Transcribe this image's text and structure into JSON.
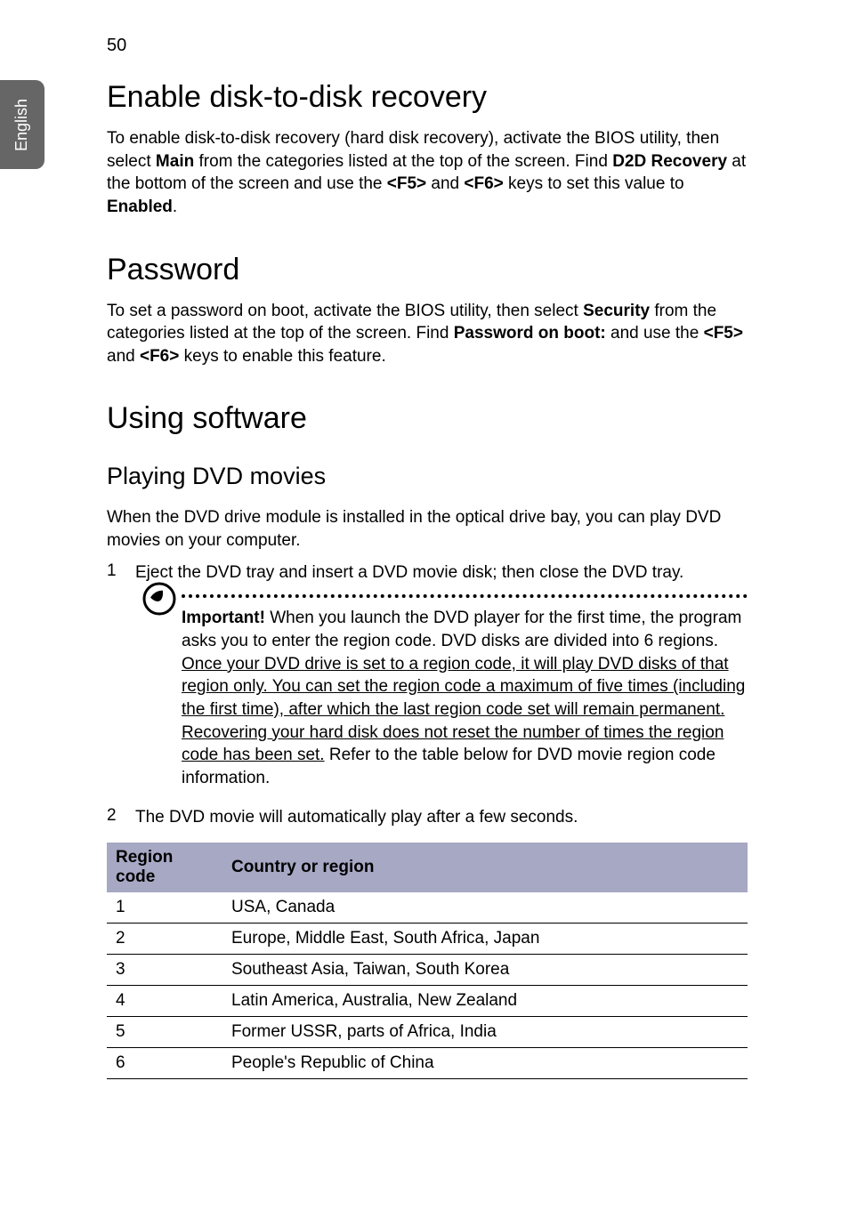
{
  "page_number": "50",
  "side_tab": "English",
  "section1": {
    "title": "Enable disk-to-disk recovery",
    "para_pre1": "To enable disk-to-disk recovery (hard disk recovery), activate the BIOS utility, then select ",
    "b1": "Main",
    "mid1": " from the categories listed at the top of the screen. Find ",
    "b2": "D2D Recovery",
    "mid2": " at the bottom of the screen and use the ",
    "b3": "<F5>",
    "mid3": " and ",
    "b4": "<F6>",
    "mid4": " keys to set this value to ",
    "b5": "Enabled",
    "end": "."
  },
  "section2": {
    "title": "Password",
    "pre1": "To set a password on boot, activate the BIOS utility, then select ",
    "b1": "Security",
    "mid1": " from the categories listed at the top of the screen. Find ",
    "b2": "Password on boot:",
    "mid2": " and use the ",
    "b3": "<F5>",
    "mid3": " and ",
    "b4": "<F6>",
    "end": " keys to enable this feature."
  },
  "section3": {
    "title": "Using software",
    "subtitle": "Playing DVD movies",
    "intro": "When the DVD drive module is installed in the optical drive bay, you can play DVD movies on your computer.",
    "step1_num": "1",
    "step1_text": "Eject the DVD tray and insert a DVD movie disk; then close the DVD tray.",
    "note": {
      "b1": "Important!",
      "t1": " When you launch the DVD player for the first time, the program asks you to enter the region code. DVD disks are divided into 6 regions. ",
      "u1": "Once your DVD drive is set to a region code, it will play DVD disks of that region only. You can set the region code a maximum of five times (including the first time), after which the last region code set will remain permanent. Recovering your hard disk does not reset the number of times the region code has been set.",
      "t2": " Refer to the table below for DVD movie region code information."
    },
    "step2_num": "2",
    "step2_text": "The DVD movie will automatically play after a few seconds.",
    "table": {
      "header1": "Region code",
      "header2": "Country or region",
      "rows": [
        {
          "code": "1",
          "region": "USA, Canada"
        },
        {
          "code": "2",
          "region": "Europe, Middle East, South Africa, Japan"
        },
        {
          "code": "3",
          "region": "Southeast Asia, Taiwan, South Korea"
        },
        {
          "code": "4",
          "region": "Latin America, Australia, New Zealand"
        },
        {
          "code": "5",
          "region": "Former USSR, parts of Africa, India"
        },
        {
          "code": "6",
          "region": "People's Republic of China"
        }
      ]
    }
  }
}
